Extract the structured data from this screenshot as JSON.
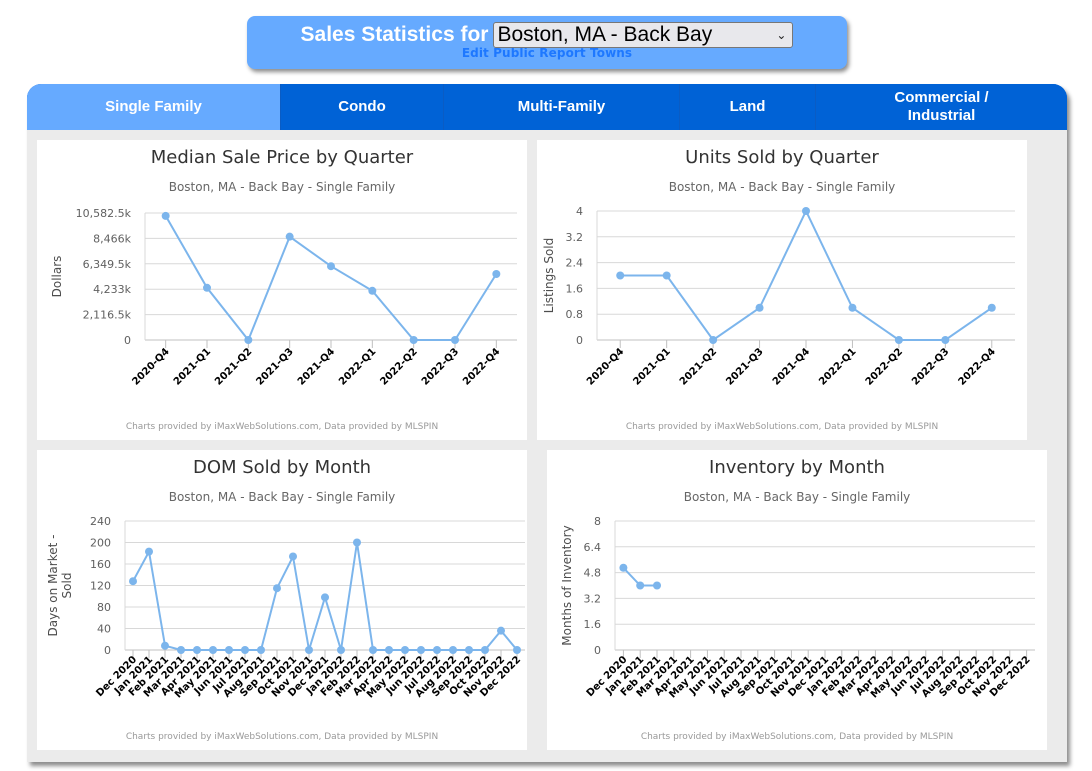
{
  "header": {
    "title": "Sales Statistics for",
    "selected_town": "Boston, MA - Back Bay",
    "edit_link": "Edit Public Report Towns"
  },
  "tabs": [
    {
      "label": "Single Family",
      "active": true
    },
    {
      "label": "Condo",
      "active": false
    },
    {
      "label": "Multi-Family",
      "active": false
    },
    {
      "label": "Land",
      "active": false
    },
    {
      "label": "Commercial / Industrial",
      "active": false
    }
  ],
  "colors": {
    "header_bg": "#66aaff",
    "tab_active": "#66aaff",
    "tab_inactive": "#0062d6",
    "series": "#7cb5ec",
    "link": "#1e78ff"
  },
  "chart_data": [
    {
      "id": "median-price",
      "type": "line",
      "title": "Median Sale Price by Quarter",
      "subtitle": "Boston, MA - Back Bay - Single Family",
      "xlabel": "",
      "ylabel": "Dollars",
      "categories": [
        "2020-Q4",
        "2021-Q1",
        "2021-Q2",
        "2021-Q3",
        "2021-Q4",
        "2022-Q1",
        "2022-Q2",
        "2022-Q3",
        "2022-Q4"
      ],
      "values": [
        10340,
        4350,
        0,
        8610,
        6150,
        4100,
        0,
        0,
        5500
      ],
      "value_unit": "thousands of dollars",
      "ylim": [
        0,
        10582.5
      ],
      "yticks": [
        0,
        2116.5,
        4233,
        6349.5,
        8466,
        10582.5
      ],
      "ytick_labels": [
        "0",
        "2,116.5k",
        "4,233k",
        "6,349.5k",
        "8,466k",
        "10,582.5k"
      ],
      "grid": true,
      "credits": "Charts provided by iMaxWebSolutions.com, Data provided by MLSPIN"
    },
    {
      "id": "units-sold",
      "type": "line",
      "title": "Units Sold by Quarter",
      "subtitle": "Boston, MA - Back Bay - Single Family",
      "xlabel": "",
      "ylabel": "Listings Sold",
      "categories": [
        "2020-Q4",
        "2021-Q1",
        "2021-Q2",
        "2021-Q3",
        "2021-Q4",
        "2022-Q1",
        "2022-Q2",
        "2022-Q3",
        "2022-Q4"
      ],
      "values": [
        2,
        2,
        0,
        1,
        4,
        1,
        0,
        0,
        1
      ],
      "ylim": [
        0,
        4
      ],
      "yticks": [
        0,
        0.8,
        1.6,
        2.4,
        3.2,
        4
      ],
      "ytick_labels": [
        "0",
        "0.8",
        "1.6",
        "2.4",
        "3.2",
        "4"
      ],
      "grid": true,
      "credits": "Charts provided by iMaxWebSolutions.com, Data provided by MLSPIN"
    },
    {
      "id": "dom-sold",
      "type": "line",
      "title": "DOM Sold by Month",
      "subtitle": "Boston, MA - Back Bay - Single Family",
      "xlabel": "",
      "ylabel": "Days on Market - Sold",
      "categories": [
        "Dec 2020",
        "Jan 2021",
        "Feb 2021",
        "Mar 2021",
        "Apr 2021",
        "May 2021",
        "Jun 2021",
        "Jul 2021",
        "Aug 2021",
        "Sep 2021",
        "Oct 2021",
        "Nov 2021",
        "Dec 2021",
        "Jan 2022",
        "Feb 2022",
        "Mar 2022",
        "Apr 2022",
        "May 2022",
        "Jun 2022",
        "Jul 2022",
        "Aug 2022",
        "Sep 2022",
        "Oct 2022",
        "Nov 2022",
        "Dec 2022"
      ],
      "values": [
        128,
        183,
        8,
        0,
        0,
        0,
        0,
        0,
        0,
        115,
        174,
        0,
        98,
        0,
        200,
        0,
        0,
        0,
        0,
        0,
        0,
        0,
        0,
        36,
        0
      ],
      "ylim": [
        0,
        240
      ],
      "yticks": [
        0,
        40,
        80,
        120,
        160,
        200,
        240
      ],
      "ytick_labels": [
        "0",
        "40",
        "80",
        "120",
        "160",
        "200",
        "240"
      ],
      "grid": true,
      "credits": "Charts provided by iMaxWebSolutions.com, Data provided by MLSPIN"
    },
    {
      "id": "inventory",
      "type": "line",
      "title": "Inventory by Month",
      "subtitle": "Boston, MA - Back Bay - Single Family",
      "xlabel": "",
      "ylabel": "Months of Inventory",
      "categories": [
        "Dec 2020",
        "Jan 2021",
        "Feb 2021",
        "Mar 2021",
        "Apr 2021",
        "May 2021",
        "Jun 2021",
        "Jul 2021",
        "Aug 2021",
        "Sep 2021",
        "Oct 2021",
        "Nov 2021",
        "Dec 2021",
        "Jan 2022",
        "Feb 2022",
        "Mar 2022",
        "Apr 2022",
        "May 2022",
        "Jun 2022",
        "Jul 2022",
        "Aug 2022",
        "Sep 2022",
        "Oct 2022",
        "Nov 2022",
        "Dec 2022"
      ],
      "values": [
        5.1,
        4.0,
        4.0,
        null,
        null,
        null,
        null,
        null,
        null,
        null,
        null,
        null,
        null,
        null,
        null,
        null,
        null,
        null,
        null,
        null,
        null,
        null,
        null,
        null,
        null
      ],
      "ylim": [
        0,
        8
      ],
      "yticks": [
        0,
        1.6,
        3.2,
        4.8,
        6.4,
        8
      ],
      "ytick_labels": [
        "0",
        "1.6",
        "3.2",
        "4.8",
        "6.4",
        "8"
      ],
      "grid": true,
      "credits": "Charts provided by iMaxWebSolutions.com, Data provided by MLSPIN"
    }
  ]
}
